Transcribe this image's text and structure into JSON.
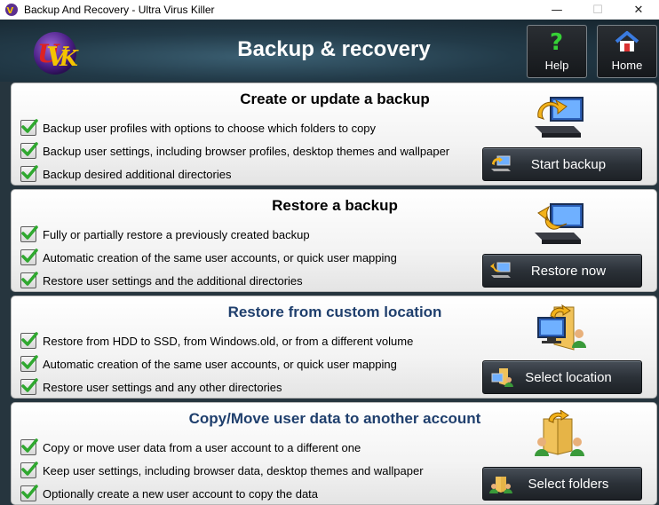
{
  "window": {
    "title": "Backup And Recovery - Ultra Virus Killer",
    "minimize": "—",
    "maximize": "☐",
    "close": "✕"
  },
  "header": {
    "title": "Backup & recovery",
    "help_label": "Help",
    "help_icon": "question-mark-icon",
    "home_label": "Home",
    "home_icon": "house-icon"
  },
  "colors": {
    "header_bg": "#223a48",
    "check_green": "#2fa82f",
    "blue_title": "#1f3f6d"
  },
  "panels": [
    {
      "title": "Create or update a backup",
      "items": [
        "Backup user profiles with options to choose which folders to copy",
        "Backup user settings, including browser profiles, desktop themes and wallpaper",
        "Backup desired additional directories"
      ],
      "button_label": "Start backup",
      "icon": "backup-computer-icon"
    },
    {
      "title": "Restore a backup",
      "items": [
        "Fully or partially restore a previously created backup",
        "Automatic creation of the same user accounts, or quick user mapping",
        "Restore user settings and the additional directories"
      ],
      "button_label": "Restore now",
      "icon": "restore-computer-icon"
    },
    {
      "title": "Restore from custom location",
      "items": [
        "Restore from HDD to SSD, from Windows.old, or from a different volume",
        "Automatic creation of the same user accounts, or quick user mapping",
        "Restore user settings and any other directories"
      ],
      "button_label": "Select location",
      "icon": "custom-location-icon"
    },
    {
      "title": "Copy/Move user data to another account",
      "items": [
        "Copy or move user data from a user account to a different one",
        "Keep user settings, including browser data, desktop themes and wallpaper",
        "Optionally create a new user account to copy the data"
      ],
      "button_label": "Select folders",
      "icon": "copy-user-folders-icon"
    }
  ]
}
